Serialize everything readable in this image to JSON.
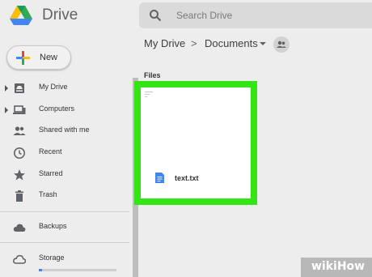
{
  "app": {
    "title": "Drive"
  },
  "search": {
    "placeholder": "Search Drive"
  },
  "sidebar": {
    "new_label": "New",
    "items": [
      {
        "label": "My Drive",
        "icon": "my-drive-icon"
      },
      {
        "label": "Computers",
        "icon": "computers-icon"
      },
      {
        "label": "Shared with me",
        "icon": "shared-icon"
      },
      {
        "label": "Recent",
        "icon": "clock-icon"
      },
      {
        "label": "Starred",
        "icon": "star-icon"
      },
      {
        "label": "Trash",
        "icon": "trash-icon"
      },
      {
        "label": "Backups",
        "icon": "cloud-icon"
      },
      {
        "label": "Storage",
        "icon": "cloud-outline-icon"
      }
    ],
    "storage_used_fraction": 0.04
  },
  "breadcrumb": {
    "root": "My Drive",
    "separator": ">",
    "current": "Documents"
  },
  "files": {
    "heading": "Files",
    "items": [
      {
        "name": "text.txt",
        "icon": "text-file-icon"
      }
    ]
  },
  "colors": {
    "highlight": "#34e515",
    "storage_fill": "#4285f4"
  },
  "watermark": {
    "text": "wikiHow"
  }
}
